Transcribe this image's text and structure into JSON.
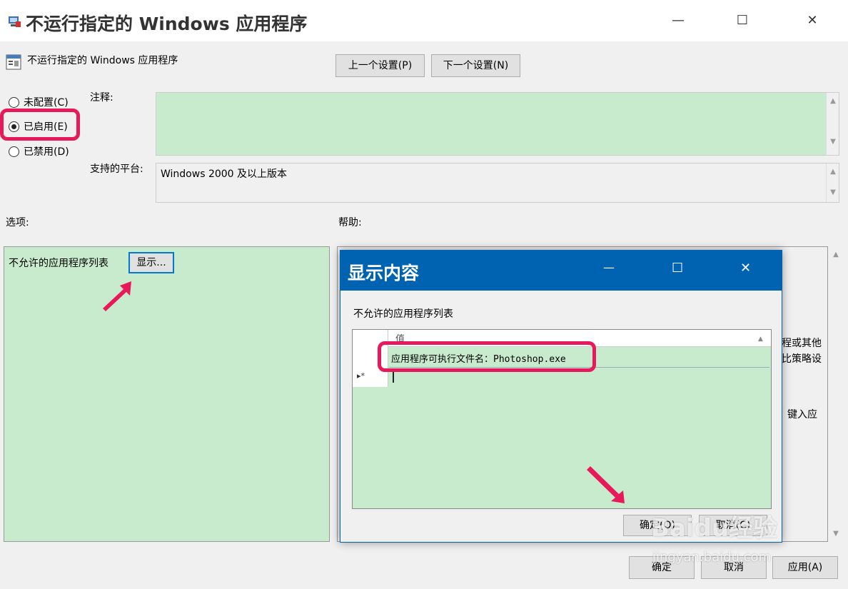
{
  "window": {
    "title": "不运行指定的 Windows 应用程序",
    "minimize": "—",
    "maximize": "☐",
    "close": "✕"
  },
  "header": {
    "policy_name": "不运行指定的 Windows 应用程序",
    "prev_button": "上一个设置(P)",
    "next_button": "下一个设置(N)"
  },
  "state": {
    "not_configured": "未配置(C)",
    "enabled": "已启用(E)",
    "disabled": "已禁用(D)",
    "selected": "enabled"
  },
  "comment": {
    "label": "注释:",
    "value": ""
  },
  "platform": {
    "label": "支持的平台:",
    "value": "Windows 2000 及以上版本"
  },
  "options": {
    "label": "选项:",
    "list_label": "不允许的应用程序列表",
    "show_button": "显示..."
  },
  "help": {
    "label": "帮助:",
    "fragment_1": "程或其他",
    "fragment_2": "比策略设",
    "fragment_3": "键入应"
  },
  "dialog": {
    "title": "显示内容",
    "minimize": "—",
    "maximize": "☐",
    "close": "✕",
    "list_label": "不允许的应用程序列表",
    "column_header": "值",
    "row_value": "应用程序可执行文件名：Photoshop.exe",
    "new_row_marker": "▸*",
    "ok_button": "确定(O)",
    "cancel_button": "取消(C)"
  },
  "footer": {
    "ok_button": "确定",
    "cancel_button": "取消",
    "apply_button": "应用(A)"
  },
  "watermark": {
    "text": "Baidu经验",
    "url": "jingyan.baidu.com"
  },
  "colors": {
    "panel_green": "#c7ebcc",
    "dialog_blue": "#0063b1",
    "highlight": "#e8195a"
  }
}
